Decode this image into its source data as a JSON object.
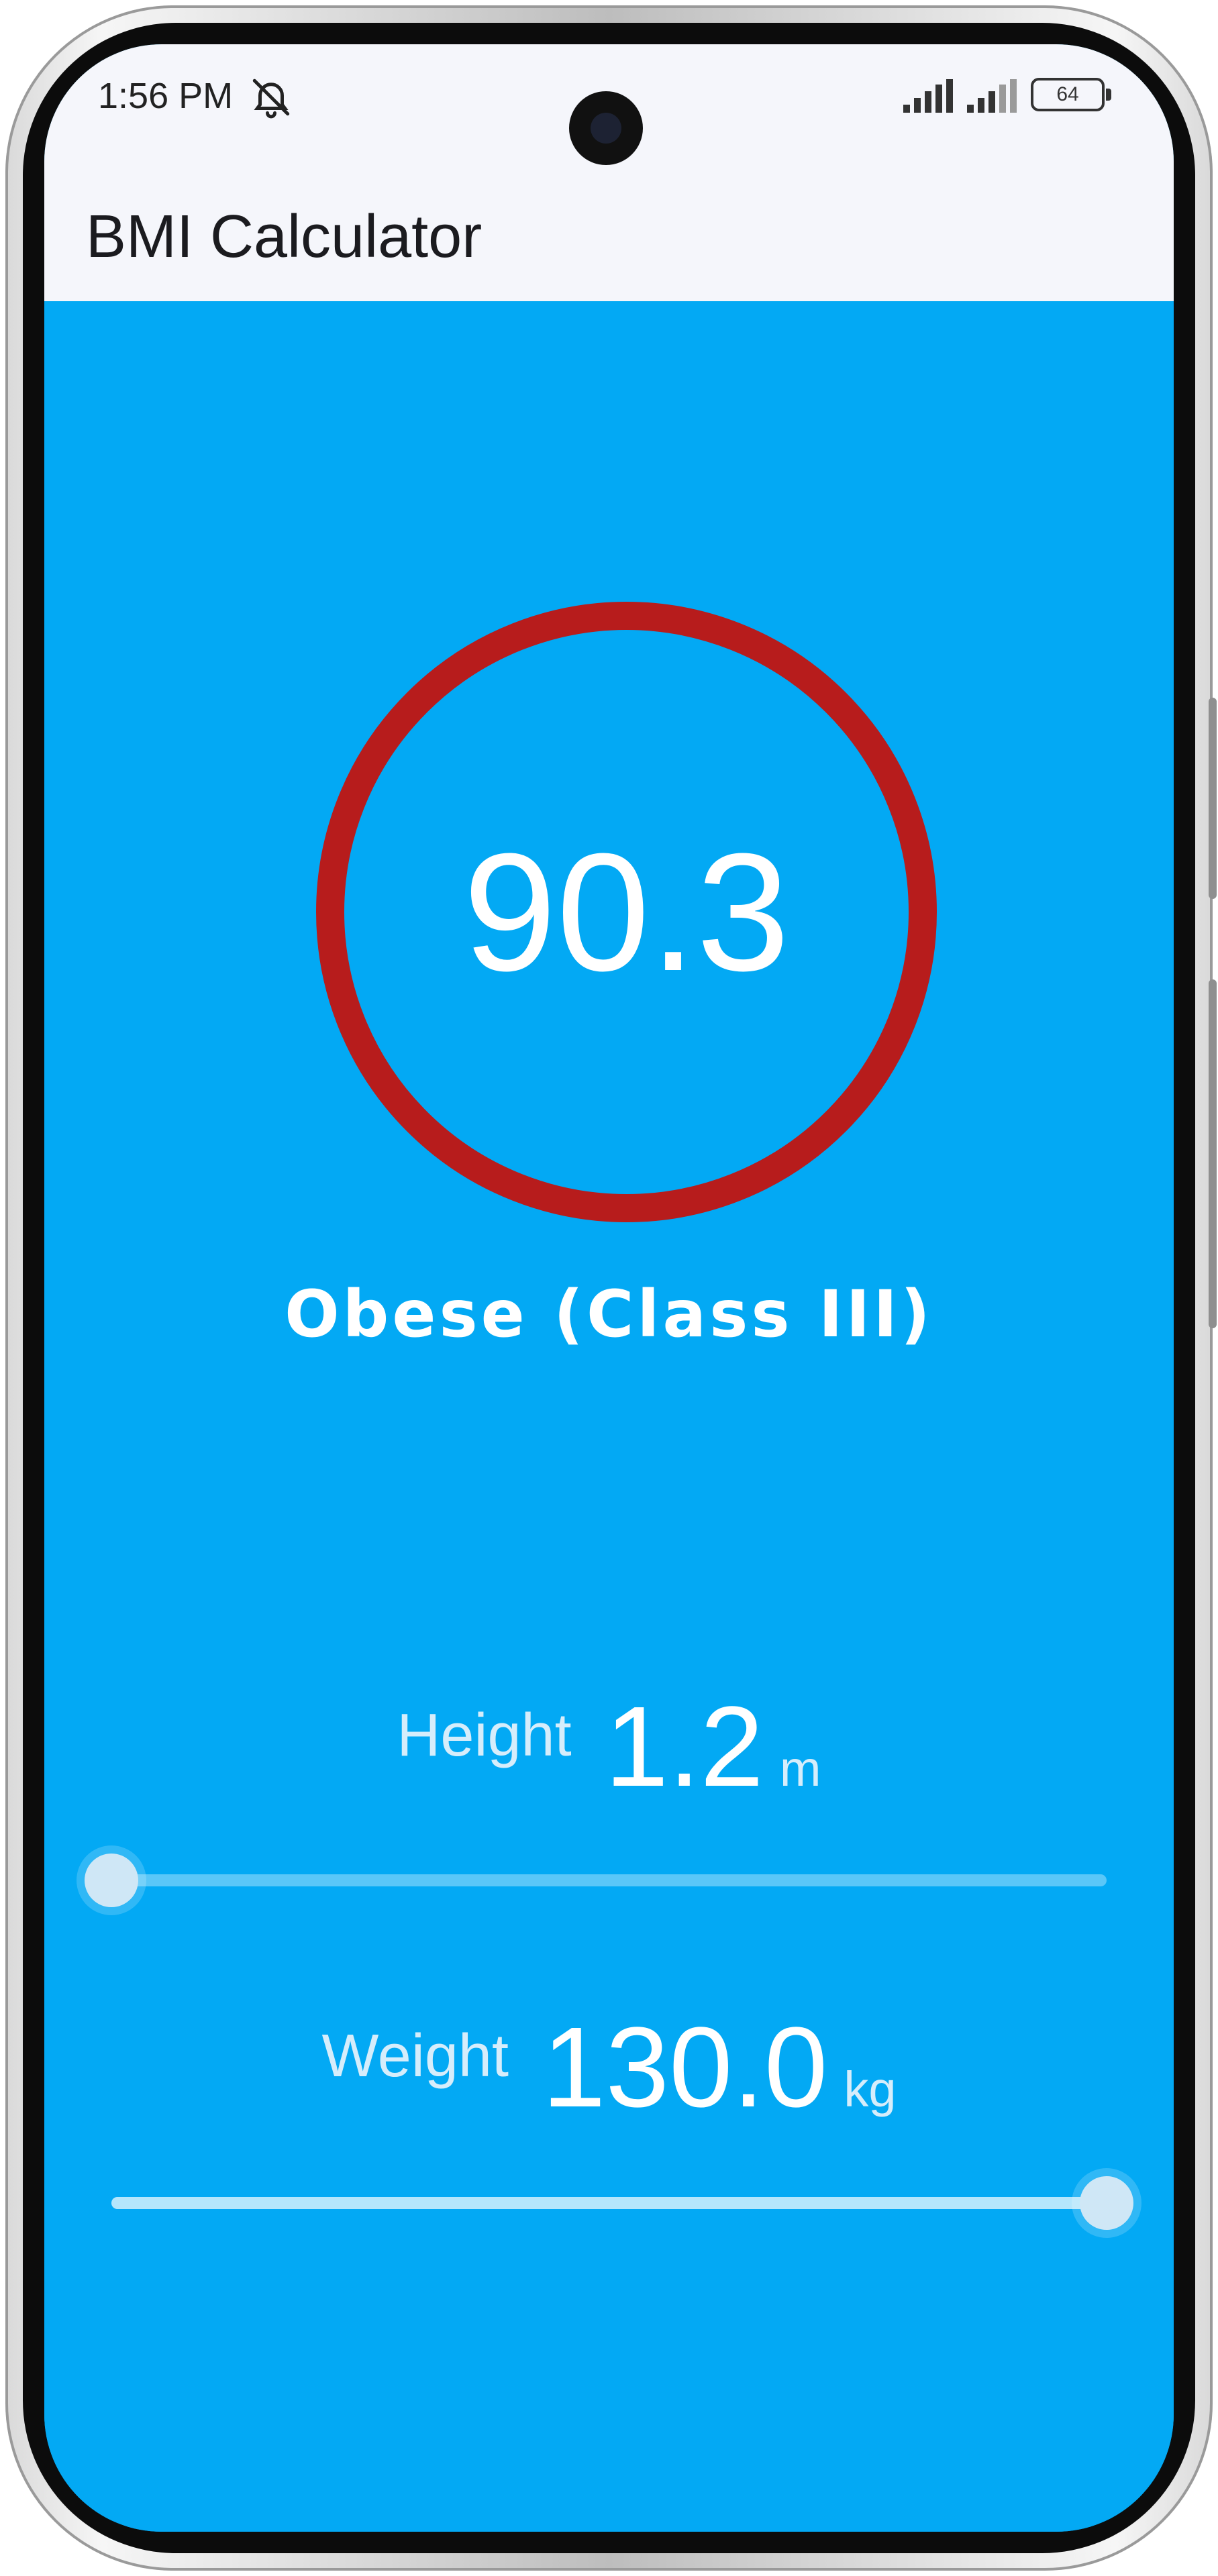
{
  "status_bar": {
    "time": "1:56 PM",
    "mute_icon": "vibrate-mute-icon",
    "signal_icon": "cell-signal-icon",
    "battery_level": "64"
  },
  "app_bar": {
    "title": "BMI Calculator"
  },
  "result": {
    "bmi": "90.3",
    "category": "Obese (Class III)",
    "ring_color": "#b71c1c"
  },
  "height": {
    "label": "Height",
    "value": "1.2",
    "unit": "m",
    "slider_fraction": 0.0
  },
  "weight": {
    "label": "Weight",
    "value": "130.0",
    "unit": "kg",
    "slider_fraction": 1.0
  },
  "colors": {
    "background": "#03a9f4",
    "app_bar": "#f5f6fb",
    "text_light": "#d6edfb"
  }
}
